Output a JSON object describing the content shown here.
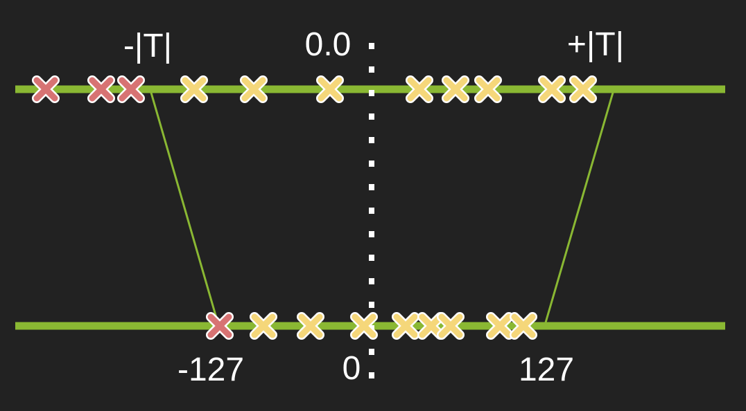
{
  "labels": {
    "neg_threshold": "-|T|",
    "pos_threshold": "+|T|",
    "float_zero": "0.0",
    "int_min": "-127",
    "int_zero": "0",
    "int_max": "127"
  },
  "colors": {
    "background": "#222222",
    "axis": "#8ab833",
    "mapping_line": "#8ab833",
    "in_range_marker": "#f5d77a",
    "clipped_marker": "#d77373",
    "zero_divider": "#ffffff",
    "marker_outline": "#ffffff"
  },
  "float_axis": {
    "range_label_left": "-|T|",
    "range_label_right": "+|T|",
    "values": [
      -1.35,
      -1.12,
      -1.05,
      -0.77,
      -0.63,
      -0.44,
      0.1,
      0.2,
      0.28,
      0.45,
      0.53
    ],
    "clipped": [
      true,
      true,
      true,
      false,
      false,
      false,
      false,
      false,
      false,
      false,
      false
    ]
  },
  "int_axis": {
    "min_label": "-127",
    "zero_label": "0",
    "max_label": "127",
    "values": [
      -127,
      -98,
      -50,
      -7,
      30,
      50,
      73,
      114,
      135
    ],
    "clipped": [
      true,
      false,
      false,
      false,
      false,
      false,
      false,
      false,
      false
    ]
  }
}
